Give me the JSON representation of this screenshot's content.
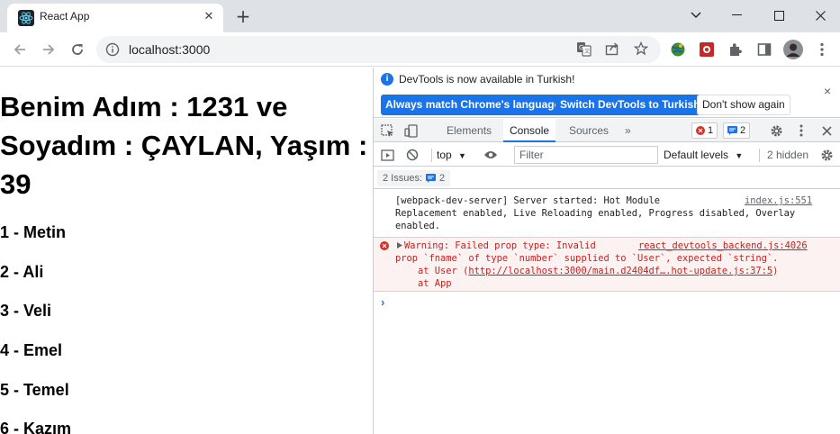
{
  "browser": {
    "tab_title": "React App",
    "tab_close": "✕",
    "new_tab": "+",
    "url": "localhost:3000",
    "window_minimize": "—",
    "window_maximize": "☐",
    "window_close": "✕"
  },
  "page": {
    "heading_line1": "Benim Adım : 1231 ve",
    "heading_line2": "Soyadım : ÇAYLAN, Yaşım :",
    "heading_line3": "39",
    "list": [
      "1 - Metin",
      "2 - Ali",
      "3 - Veli",
      "4 - Emel",
      "5 - Temel",
      "6 - Kazım"
    ]
  },
  "devtools": {
    "info": {
      "message": "DevTools is now available in Turkish!",
      "btn_match": "Always match Chrome's language",
      "btn_switch": "Switch DevTools to Turkish",
      "btn_dismiss": "Don't show again",
      "close": "×"
    },
    "tabs": [
      "Elements",
      "Console",
      "Sources",
      "»"
    ],
    "active_tab": "Console",
    "error_count": "1",
    "message_count": "2",
    "console_toolbar": {
      "context": "top",
      "filter_placeholder": "Filter",
      "levels": "Default levels",
      "hidden": "2 hidden"
    },
    "issues": {
      "label": "2 Issues:",
      "count": "2"
    },
    "messages": {
      "log_line1": "[webpack-dev-server] Server started: Hot Module",
      "log_line2": "Replacement enabled, Live Reloading enabled, Progress disabled, Overlay",
      "log_line3": "enabled.",
      "log_source": "index.js:551",
      "warn_line1": "Warning: Failed prop type: Invalid",
      "warn_line2": "prop `fname` of type `number` supplied to `User`, expected `string`.",
      "warn_line3_prefix": "    at User (",
      "warn_line3_link": "http://localhost:3000/main.d2404df….hot-update.js:37:5",
      "warn_line3_suffix": ")",
      "warn_line4": "    at App",
      "warn_source": "react_devtools_backend.js:4026"
    },
    "prompt": "›"
  },
  "colors": {
    "accent": "#1a73e8",
    "error": "#c5221f",
    "tabstrip": "#dee1e6"
  }
}
